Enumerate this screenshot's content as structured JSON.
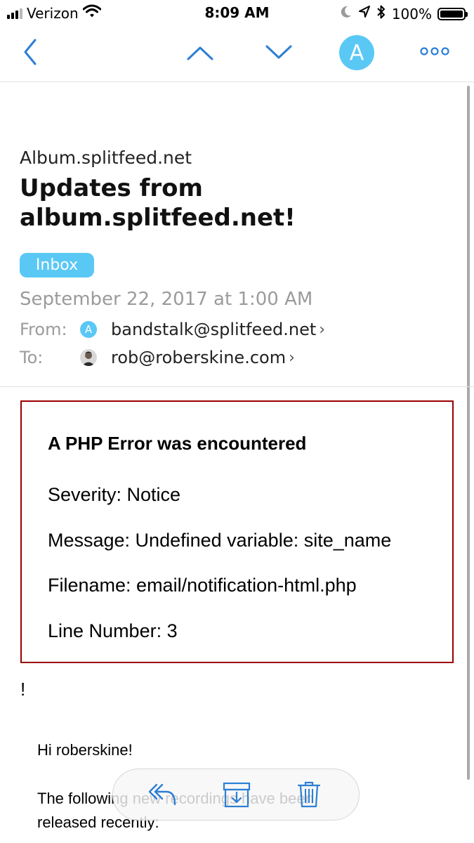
{
  "status_bar": {
    "carrier": "Verizon",
    "time": "8:09 AM",
    "battery_percent": "100%",
    "signal_bars_filled": 3,
    "signal_bars_total": 4,
    "battery_level": 1.0,
    "icons": [
      "wifi-icon",
      "moon-icon",
      "location-arrow-icon",
      "bluetooth-icon",
      "battery-icon"
    ]
  },
  "nav": {
    "account_initial": "A",
    "icons": [
      "back-chevron-icon",
      "previous-message-icon",
      "next-message-icon",
      "more-icon"
    ]
  },
  "email": {
    "sender_name": "Album.splitfeed.net",
    "subject": "Updates from album.splitfeed.net!",
    "folder_label": "Inbox",
    "date": "September 22, 2017 at 1:00 AM",
    "from_label": "From:",
    "from_initial": "A",
    "from_address": "bandstalk@splitfeed.net",
    "to_label": "To:",
    "to_address": "rob@roberskine.com"
  },
  "body": {
    "error_title": "A PHP Error was encountered",
    "severity": "Severity: Notice",
    "message": "Message: Undefined variable: site_name",
    "filename": "Filename: email/notification-html.php",
    "line_number": "Line Number: 3",
    "exclamation": "!",
    "greeting": "Hi roberskine!",
    "intro": "The following new recordings have been released recently:"
  },
  "toolbar": {
    "icons": [
      "reply-icon",
      "archive-icon",
      "trash-icon"
    ]
  },
  "colors": {
    "accent": "#5ac8f5",
    "nav_icon": "#2b7fd4",
    "error_border": "#990000",
    "meta_gray": "#9b9b9b"
  }
}
